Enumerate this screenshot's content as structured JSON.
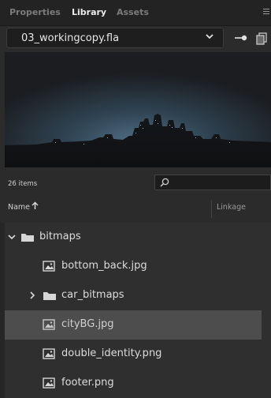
{
  "tabs": [
    {
      "label": "Properties",
      "active": false
    },
    {
      "label": "Library",
      "active": true
    },
    {
      "label": "Assets",
      "active": false
    }
  ],
  "document": {
    "name": "03_workingcopy.fla"
  },
  "library": {
    "item_count": "26 items",
    "search_placeholder": "",
    "columns": {
      "name": "Name",
      "linkage": "Linkage"
    },
    "items": [
      {
        "label": "bitmaps",
        "type": "folder",
        "expanded": true
      },
      {
        "label": "bottom_back.jpg",
        "type": "bitmap"
      },
      {
        "label": "car_bitmaps",
        "type": "folder",
        "expanded": false
      },
      {
        "label": "cityBG.jpg",
        "type": "bitmap",
        "selected": true
      },
      {
        "label": "double_identity.png",
        "type": "bitmap"
      },
      {
        "label": "footer.png",
        "type": "bitmap"
      }
    ]
  },
  "colors": {
    "panel_bg": "#2b2b2b",
    "selected_row": "#4d4d4d",
    "text": "#dcdcdc"
  }
}
